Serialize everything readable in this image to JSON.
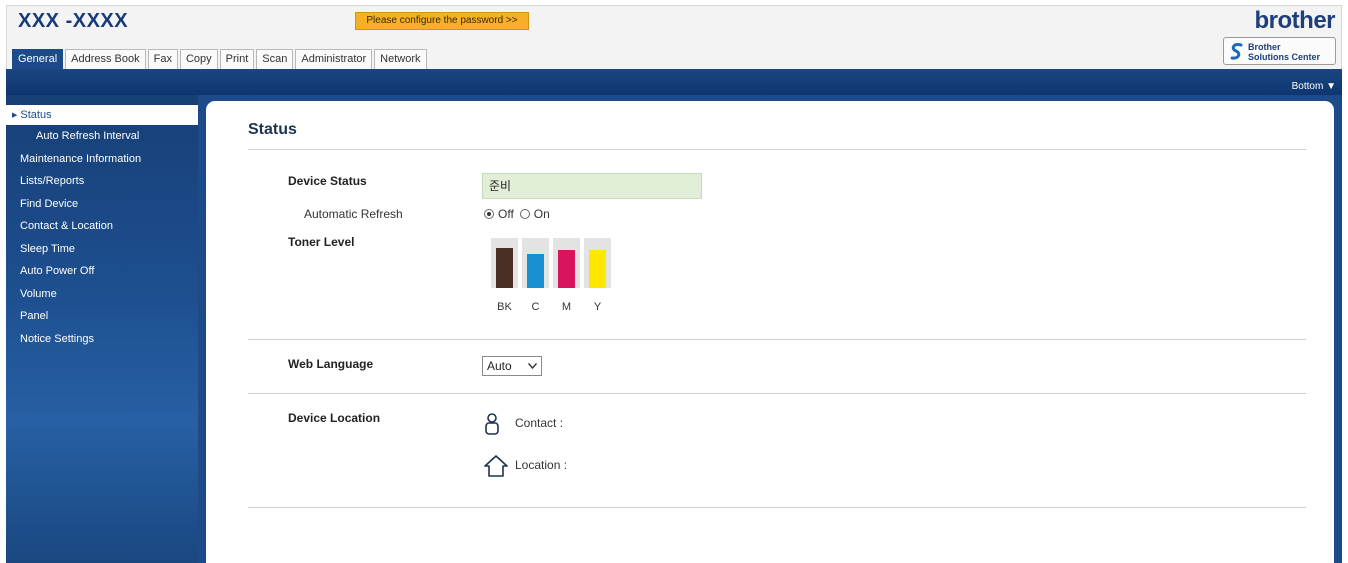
{
  "header": {
    "model": "XXX -XXXX",
    "password_prompt": "Please configure the password >>",
    "brand": "brother"
  },
  "tabs": [
    {
      "label": "General",
      "active": true
    },
    {
      "label": "Address Book"
    },
    {
      "label": "Fax"
    },
    {
      "label": "Copy"
    },
    {
      "label": "Print"
    },
    {
      "label": "Scan"
    },
    {
      "label": "Administrator"
    },
    {
      "label": "Network"
    }
  ],
  "solutions_center": {
    "line1": "Brother",
    "line2": "Solutions Center"
  },
  "bottom_link": "Bottom ▼",
  "sidebar": {
    "items": [
      {
        "label": "Status",
        "active": true
      },
      {
        "label": "Auto Refresh Interval",
        "sub": true
      },
      {
        "label": "Maintenance Information"
      },
      {
        "label": "Lists/Reports"
      },
      {
        "label": "Find Device"
      },
      {
        "label": "Contact & Location"
      },
      {
        "label": "Sleep Time"
      },
      {
        "label": "Auto Power Off"
      },
      {
        "label": "Volume"
      },
      {
        "label": "Panel"
      },
      {
        "label": "Notice Settings"
      }
    ]
  },
  "main": {
    "title": "Status",
    "device_status_label": "Device Status",
    "device_status_value": "준비",
    "auto_refresh_label": "Automatic Refresh",
    "auto_refresh_off": "Off",
    "auto_refresh_on": "On",
    "auto_refresh_selected": "Off",
    "toner_label": "Toner Level",
    "toners": [
      {
        "label": "BK",
        "color": "#4a3024"
      },
      {
        "label": "C",
        "color": "#1a8fd0"
      },
      {
        "label": "M",
        "color": "#d8145e"
      },
      {
        "label": "Y",
        "color": "#fde700"
      }
    ],
    "web_language_label": "Web Language",
    "web_language_value": "Auto",
    "device_location_label": "Device Location",
    "contact_label": "Contact :",
    "location_label": "Location :"
  },
  "colors": {
    "accent_blue": "#1d4b8a",
    "password_button": "#f5b028",
    "status_box": "#e1efd8"
  }
}
